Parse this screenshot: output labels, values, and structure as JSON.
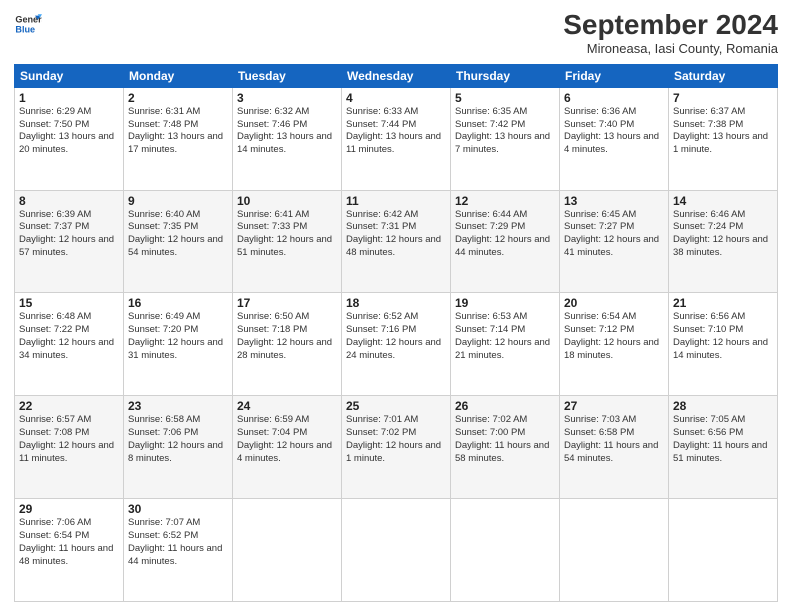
{
  "header": {
    "logo_line1": "General",
    "logo_line2": "Blue",
    "month": "September 2024",
    "location": "Mironeasa, Iasi County, Romania"
  },
  "days_of_week": [
    "Sunday",
    "Monday",
    "Tuesday",
    "Wednesday",
    "Thursday",
    "Friday",
    "Saturday"
  ],
  "weeks": [
    [
      {
        "day": "1",
        "sunrise": "6:29 AM",
        "sunset": "7:50 PM",
        "daylight": "13 hours and 20 minutes."
      },
      {
        "day": "2",
        "sunrise": "6:31 AM",
        "sunset": "7:48 PM",
        "daylight": "13 hours and 17 minutes."
      },
      {
        "day": "3",
        "sunrise": "6:32 AM",
        "sunset": "7:46 PM",
        "daylight": "13 hours and 14 minutes."
      },
      {
        "day": "4",
        "sunrise": "6:33 AM",
        "sunset": "7:44 PM",
        "daylight": "13 hours and 11 minutes."
      },
      {
        "day": "5",
        "sunrise": "6:35 AM",
        "sunset": "7:42 PM",
        "daylight": "13 hours and 7 minutes."
      },
      {
        "day": "6",
        "sunrise": "6:36 AM",
        "sunset": "7:40 PM",
        "daylight": "13 hours and 4 minutes."
      },
      {
        "day": "7",
        "sunrise": "6:37 AM",
        "sunset": "7:38 PM",
        "daylight": "13 hours and 1 minute."
      }
    ],
    [
      {
        "day": "8",
        "sunrise": "6:39 AM",
        "sunset": "7:37 PM",
        "daylight": "12 hours and 57 minutes."
      },
      {
        "day": "9",
        "sunrise": "6:40 AM",
        "sunset": "7:35 PM",
        "daylight": "12 hours and 54 minutes."
      },
      {
        "day": "10",
        "sunrise": "6:41 AM",
        "sunset": "7:33 PM",
        "daylight": "12 hours and 51 minutes."
      },
      {
        "day": "11",
        "sunrise": "6:42 AM",
        "sunset": "7:31 PM",
        "daylight": "12 hours and 48 minutes."
      },
      {
        "day": "12",
        "sunrise": "6:44 AM",
        "sunset": "7:29 PM",
        "daylight": "12 hours and 44 minutes."
      },
      {
        "day": "13",
        "sunrise": "6:45 AM",
        "sunset": "7:27 PM",
        "daylight": "12 hours and 41 minutes."
      },
      {
        "day": "14",
        "sunrise": "6:46 AM",
        "sunset": "7:24 PM",
        "daylight": "12 hours and 38 minutes."
      }
    ],
    [
      {
        "day": "15",
        "sunrise": "6:48 AM",
        "sunset": "7:22 PM",
        "daylight": "12 hours and 34 minutes."
      },
      {
        "day": "16",
        "sunrise": "6:49 AM",
        "sunset": "7:20 PM",
        "daylight": "12 hours and 31 minutes."
      },
      {
        "day": "17",
        "sunrise": "6:50 AM",
        "sunset": "7:18 PM",
        "daylight": "12 hours and 28 minutes."
      },
      {
        "day": "18",
        "sunrise": "6:52 AM",
        "sunset": "7:16 PM",
        "daylight": "12 hours and 24 minutes."
      },
      {
        "day": "19",
        "sunrise": "6:53 AM",
        "sunset": "7:14 PM",
        "daylight": "12 hours and 21 minutes."
      },
      {
        "day": "20",
        "sunrise": "6:54 AM",
        "sunset": "7:12 PM",
        "daylight": "12 hours and 18 minutes."
      },
      {
        "day": "21",
        "sunrise": "6:56 AM",
        "sunset": "7:10 PM",
        "daylight": "12 hours and 14 minutes."
      }
    ],
    [
      {
        "day": "22",
        "sunrise": "6:57 AM",
        "sunset": "7:08 PM",
        "daylight": "12 hours and 11 minutes."
      },
      {
        "day": "23",
        "sunrise": "6:58 AM",
        "sunset": "7:06 PM",
        "daylight": "12 hours and 8 minutes."
      },
      {
        "day": "24",
        "sunrise": "6:59 AM",
        "sunset": "7:04 PM",
        "daylight": "12 hours and 4 minutes."
      },
      {
        "day": "25",
        "sunrise": "7:01 AM",
        "sunset": "7:02 PM",
        "daylight": "12 hours and 1 minute."
      },
      {
        "day": "26",
        "sunrise": "7:02 AM",
        "sunset": "7:00 PM",
        "daylight": "11 hours and 58 minutes."
      },
      {
        "day": "27",
        "sunrise": "7:03 AM",
        "sunset": "6:58 PM",
        "daylight": "11 hours and 54 minutes."
      },
      {
        "day": "28",
        "sunrise": "7:05 AM",
        "sunset": "6:56 PM",
        "daylight": "11 hours and 51 minutes."
      }
    ],
    [
      {
        "day": "29",
        "sunrise": "7:06 AM",
        "sunset": "6:54 PM",
        "daylight": "11 hours and 48 minutes."
      },
      {
        "day": "30",
        "sunrise": "7:07 AM",
        "sunset": "6:52 PM",
        "daylight": "11 hours and 44 minutes."
      },
      null,
      null,
      null,
      null,
      null
    ]
  ]
}
